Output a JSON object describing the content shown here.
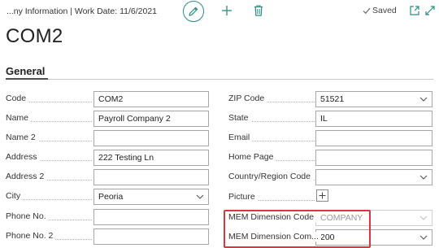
{
  "header": {
    "breadcrumb": "...ny Information | Work Date: 11/6/2021",
    "saved_label": "Saved"
  },
  "page": {
    "title": "COM2"
  },
  "section": {
    "title": "General"
  },
  "left_fields": [
    {
      "label": "Code",
      "value": "COM2",
      "type": "text"
    },
    {
      "label": "Name",
      "value": "Payroll Company 2",
      "type": "text"
    },
    {
      "label": "Name 2",
      "value": "",
      "type": "text"
    },
    {
      "label": "Address",
      "value": "222 Testing Ln",
      "type": "text"
    },
    {
      "label": "Address 2",
      "value": "",
      "type": "text"
    },
    {
      "label": "City",
      "value": "Peoria",
      "type": "dropdown"
    },
    {
      "label": "Phone No.",
      "value": "",
      "type": "text"
    },
    {
      "label": "Phone No. 2",
      "value": "",
      "type": "text"
    }
  ],
  "right_fields": [
    {
      "label": "ZIP Code",
      "value": "51521",
      "type": "dropdown"
    },
    {
      "label": "State",
      "value": "IL",
      "type": "text"
    },
    {
      "label": "Email",
      "value": "",
      "type": "text"
    },
    {
      "label": "Home Page",
      "value": "",
      "type": "text"
    },
    {
      "label": "Country/Region Code",
      "value": "",
      "type": "dropdown"
    },
    {
      "label": "Picture",
      "value": "",
      "type": "picture"
    },
    {
      "label": "MEM Dimension Code",
      "value": "COMPANY",
      "type": "dropdown-readonly"
    },
    {
      "label": "MEM Dimension Com...",
      "value": "200",
      "type": "dropdown"
    }
  ],
  "colors": {
    "accent": "#2a8c84",
    "highlight": "#d9363e"
  },
  "icons": [
    "edit-icon",
    "add-icon",
    "delete-icon",
    "checkmark-icon",
    "popout-icon",
    "expand-icon",
    "chevron-down-icon",
    "plus-icon"
  ]
}
